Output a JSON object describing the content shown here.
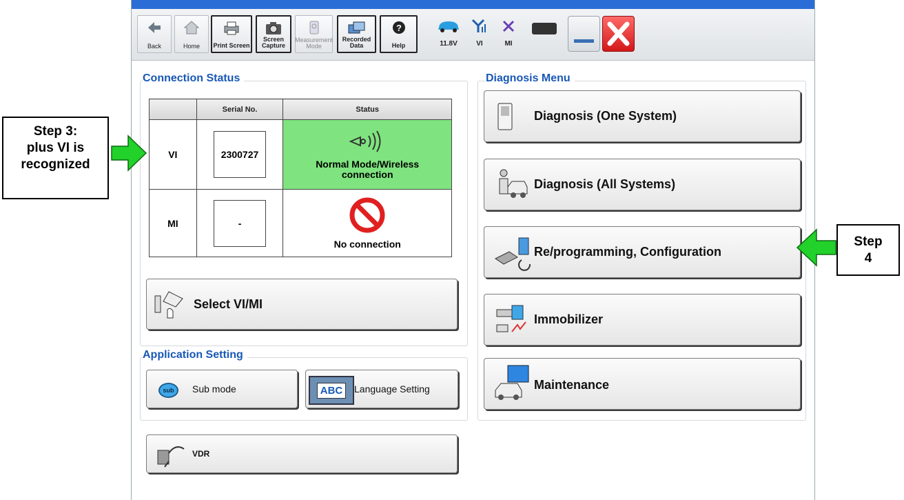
{
  "toolbar": {
    "back": "Back",
    "home": "Home",
    "print_screen": "Print Screen",
    "screen_capture": "Screen\nCapture",
    "measurement_mode": "Measurement\nMode",
    "recorded_data": "Recorded\nData",
    "help": "Help",
    "battery_voltage": "11.8V",
    "vi_label": "VI",
    "mi_label": "MI"
  },
  "connection_status": {
    "title": "Connection Status",
    "col_serial": "Serial No.",
    "col_status": "Status",
    "rows": [
      {
        "device": "VI",
        "serial": "2300727",
        "status": "Normal Mode/Wireless connection"
      },
      {
        "device": "MI",
        "serial": "-",
        "status": "No connection"
      }
    ],
    "select_button": "Select VI/MI"
  },
  "application_setting": {
    "title": "Application Setting",
    "sub_mode": "Sub mode",
    "sub_icon": "sub",
    "language_setting": "Language Setting",
    "abc_icon": "ABC"
  },
  "vdr": "VDR",
  "diagnosis_menu": {
    "title": "Diagnosis Menu",
    "items": [
      {
        "label": "Diagnosis (One System)"
      },
      {
        "label": "Diagnosis (All Systems)"
      },
      {
        "label": "Re/programming, Configuration"
      },
      {
        "label": "Immobilizer"
      },
      {
        "label": "Maintenance"
      }
    ]
  },
  "annotations": {
    "step3": "Step 3:\nplus VI is\nrecognized",
    "step4": "Step\n4"
  },
  "colors": {
    "accent": "#1858b6",
    "status_ok": "#7fe47f",
    "arrow": "#22d12a",
    "close": "#e02020"
  }
}
